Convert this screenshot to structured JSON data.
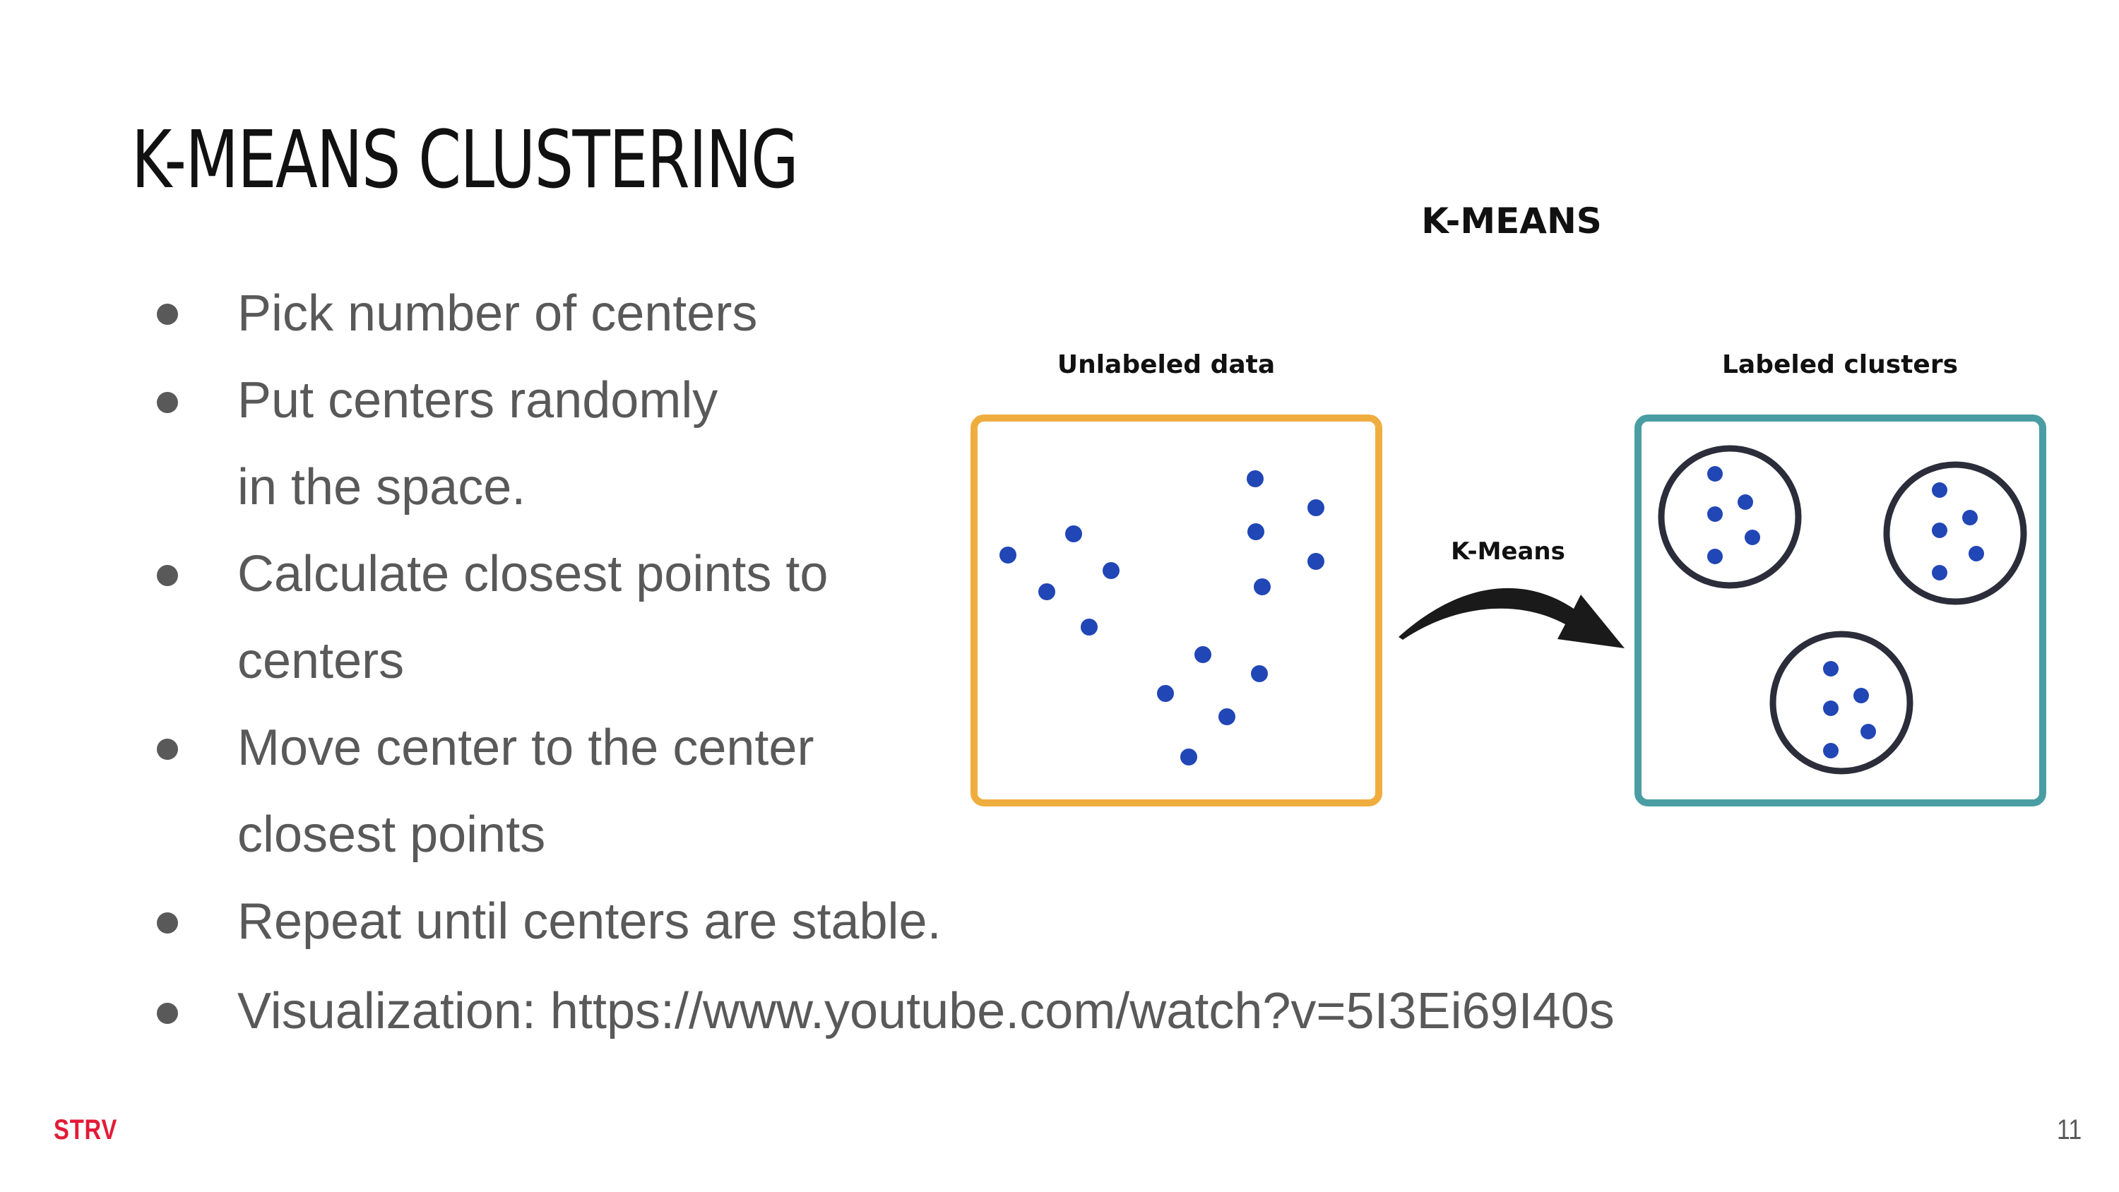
{
  "slide": {
    "title": "K-MEANS CLUSTERING",
    "bullets": [
      {
        "text": "Pick number of centers",
        "continuation": ""
      },
      {
        "text": "Put centers randomly",
        "continuation": "in the space."
      },
      {
        "text": "Calculate closest points to",
        "continuation": "centers"
      },
      {
        "text": "Move center to the center",
        "continuation": "closest points"
      },
      {
        "text": "Repeat until centers are stable.",
        "continuation": ""
      },
      {
        "text": "Visualization: https://www.youtube.com/watch?v=5I3Ei69I40s",
        "continuation": ""
      }
    ],
    "brand": "STRV",
    "page_number": "11"
  },
  "diagram": {
    "title": "K-MEANS",
    "left_panel_label": "Unlabeled data",
    "right_panel_label": "Labeled clusters",
    "arrow_label": "K-Means",
    "colors": {
      "point": "#2146b5",
      "unlabeled_border": "#f0ad3f",
      "labeled_border": "#4a9ea3",
      "circle": "#2b2d3a",
      "arrow": "#1a1a1a"
    }
  }
}
